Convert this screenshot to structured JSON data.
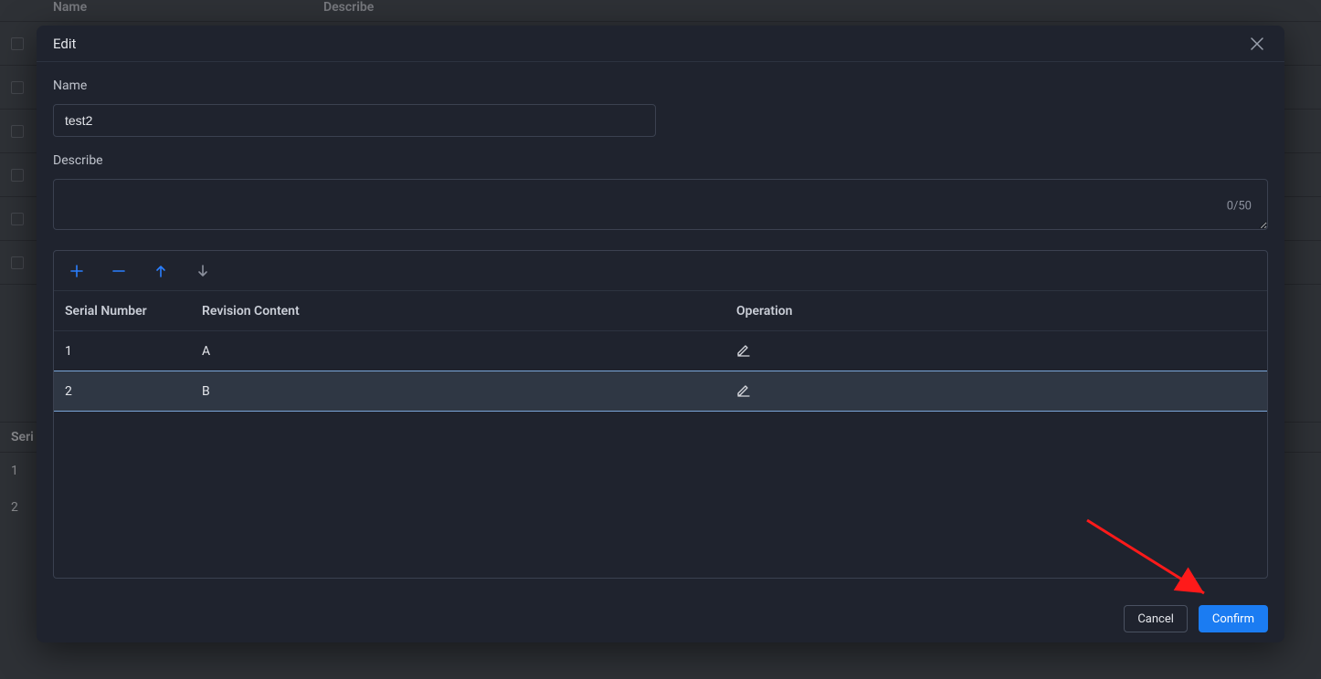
{
  "background": {
    "header_name": "Name",
    "header_desc": "Describe",
    "sub_header": "Seri",
    "sub_row1": "1",
    "sub_row2": "2"
  },
  "dialog": {
    "title": "Edit",
    "name_label": "Name",
    "name_value": "test2",
    "describe_label": "Describe",
    "describe_value": "",
    "char_count": "0/50",
    "table": {
      "col_serial": "Serial Number",
      "col_revision": "Revision Content",
      "col_operation": "Operation",
      "rows": [
        {
          "serial": "1",
          "content": "A"
        },
        {
          "serial": "2",
          "content": "B"
        }
      ]
    },
    "cancel": "Cancel",
    "confirm": "Confirm"
  },
  "icons": {
    "close": "close-icon",
    "plus": "plus-icon",
    "minus": "minus-icon",
    "up": "arrow-up-icon",
    "down": "arrow-down-icon",
    "edit": "edit-icon"
  }
}
